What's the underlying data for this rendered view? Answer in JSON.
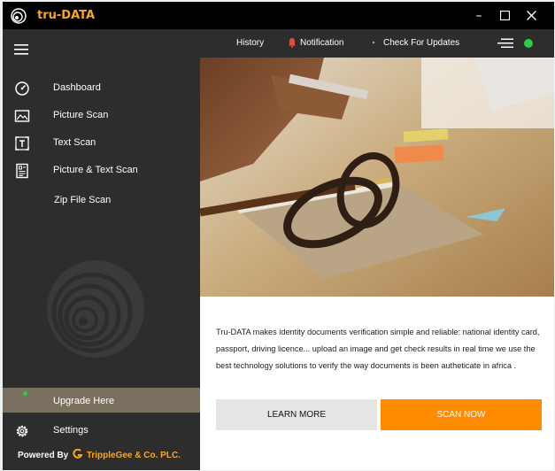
{
  "window": {
    "title": "tru-DATA",
    "controls": {
      "minimize": "–",
      "maximize": "☐",
      "close": "✕"
    }
  },
  "sidebar": {
    "items": [
      {
        "label": "Dashboard",
        "icon": "dashboard-gauge-icon"
      },
      {
        "label": "Picture Scan",
        "icon": "picture-icon"
      },
      {
        "label": "Text Scan",
        "icon": "text-scan-icon"
      },
      {
        "label": "Picture & Text Scan",
        "icon": "picture-text-scan-icon"
      },
      {
        "label": "Zip File  Scan",
        "icon": ""
      }
    ],
    "upgrade_label": "Upgrade Here",
    "settings_label": "Settings",
    "powered_prefix": "Powered By ",
    "powered_brand": "TrippleGee & Co. PLC."
  },
  "topnav": {
    "history": "History",
    "notification": "Notification",
    "check_updates": "Check For Updates",
    "status_color": "#2ecc40"
  },
  "main": {
    "description": "Tru-DATA makes identity documents verification simple and reliable: national identity card, passport, driving licence... upload an image and get check results in real time we use the best technology solutions to  verify  the way documents is been  autheticate in africa .",
    "learn_more": "LEARN MORE",
    "scan_now": "SCAN NOW"
  },
  "colors": {
    "accent": "#ff8c00",
    "brand": "#f7a823",
    "sidebar_bg": "#2d2d2d",
    "titlebar_bg": "#000000"
  }
}
